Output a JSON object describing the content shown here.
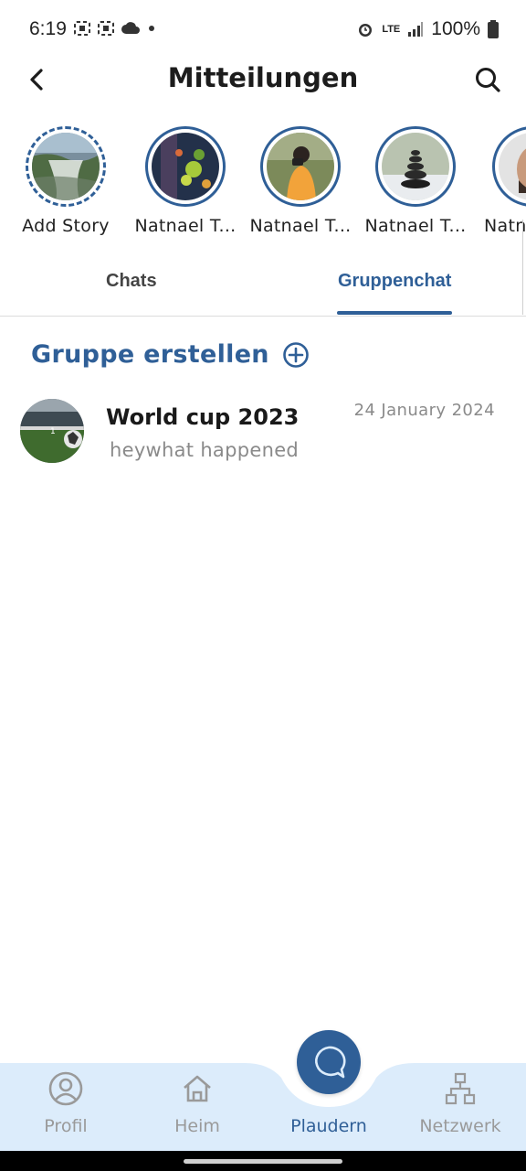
{
  "status_bar": {
    "time": "6:19",
    "network": "LTE",
    "battery": "100%"
  },
  "header": {
    "title": "Mitteilungen"
  },
  "stories": [
    {
      "label": "Add Story",
      "kind": "add"
    },
    {
      "label": "Natnael T...",
      "kind": "user"
    },
    {
      "label": "Natnael T...",
      "kind": "user"
    },
    {
      "label": "Natnael T...",
      "kind": "user"
    },
    {
      "label": "Natn",
      "kind": "user"
    }
  ],
  "tabs": {
    "chats": "Chats",
    "group_chat": "Gruppenchat",
    "active": "group_chat"
  },
  "create_group": {
    "label": "Gruppe erstellen"
  },
  "group_chats": [
    {
      "name": "World cup 2023",
      "date": "24 January 2024",
      "last_message": "heywhat happened"
    }
  ],
  "bottom_nav": {
    "profile": "Profil",
    "home": "Heim",
    "chat": "Plaudern",
    "network": "Netzwerk",
    "active": "chat"
  },
  "colors": {
    "accent": "#2f5f97",
    "nav_bg": "#dcecfb",
    "muted": "#8a8a8a"
  }
}
